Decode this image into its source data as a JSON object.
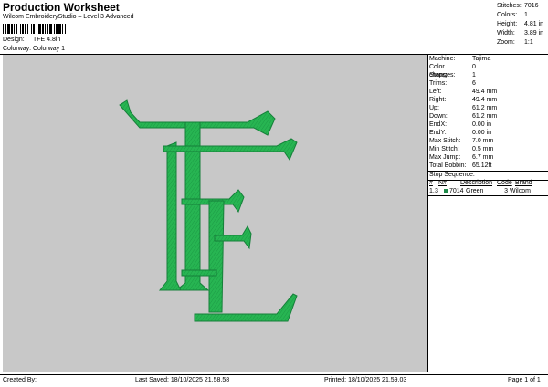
{
  "header": {
    "title": "Production Worksheet",
    "subtitle": "Wilcom EmbroideryStudio – Level 3 Advanced",
    "design_label": "Design:",
    "design_value": "TFE 4.8in",
    "colorway_label": "Colorway:",
    "colorway_value": "Colorway 1"
  },
  "stats": [
    {
      "label": "Stitches:",
      "value": "7016"
    },
    {
      "label": "Colors:",
      "value": "1"
    },
    {
      "label": "Height:",
      "value": "4.81 in"
    },
    {
      "label": "Width:",
      "value": "3.89 in"
    },
    {
      "label": "Zoom:",
      "value": "1:1"
    }
  ],
  "info": [
    {
      "label": "Machine:",
      "value": "Tajima"
    },
    {
      "label": "Color changes:",
      "value": "0"
    },
    {
      "label": "Stops:",
      "value": "1"
    },
    {
      "label": "Trims:",
      "value": "6"
    },
    {
      "label": "Left:",
      "value": "49.4 mm"
    },
    {
      "label": "Right:",
      "value": "49.4 mm"
    },
    {
      "label": "Up:",
      "value": "61.2 mm"
    },
    {
      "label": "Down:",
      "value": "61.2 mm"
    },
    {
      "label": "EndX:",
      "value": "0.00 in"
    },
    {
      "label": "EndY:",
      "value": "0.00 in"
    },
    {
      "label": "Max Stitch:",
      "value": "7.0 mm"
    },
    {
      "label": "Min Stitch:",
      "value": "0.5 mm"
    },
    {
      "label": "Max Jump:",
      "value": "6.7 mm"
    },
    {
      "label": "Total Bobbin:",
      "value": "65.12ft"
    }
  ],
  "stop_sequence": {
    "title": "Stop Sequence:",
    "headers": [
      "#",
      "N#",
      "Description",
      "Code",
      "Brand"
    ],
    "rows": [
      {
        "index": "1.",
        "stop": "3",
        "number": "7014",
        "description": "Green",
        "code": "3",
        "brand": "Wilcom",
        "color": "#1f8a4a"
      }
    ]
  },
  "design": {
    "thread_color": "#27b552",
    "thread_dark": "#16803a",
    "background": "#c8c8c8"
  },
  "footer": {
    "created_by": "Created By:",
    "last_saved": "Last Saved: 18/10/2025 21.58.58",
    "printed": "Printed: 18/10/2025 21.59.03",
    "page": "Page 1 of 1"
  }
}
